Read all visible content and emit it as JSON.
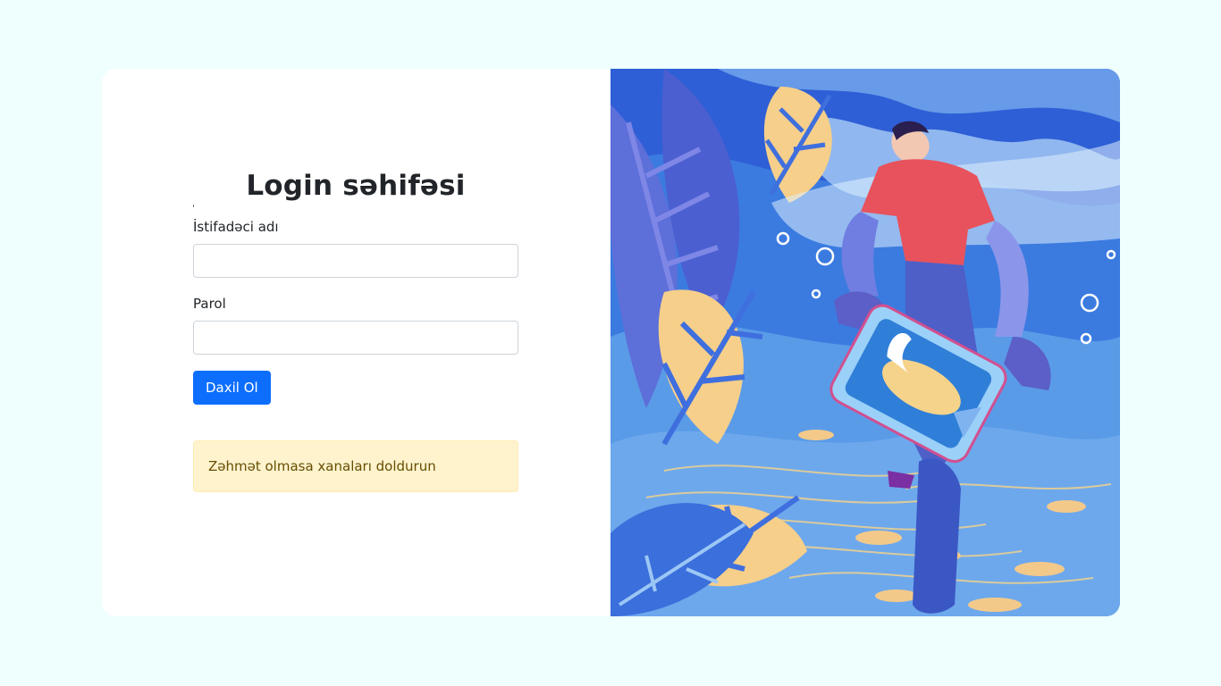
{
  "login": {
    "title": "Login səhifəsi",
    "username_label": "İstifadəci adı",
    "username_value": "",
    "password_label": "Parol",
    "password_value": "",
    "submit_label": "Daxil Ol",
    "alert_message": "Zəhmət olmasa xanaları doldurun"
  },
  "colors": {
    "page_background": "#eefffe",
    "primary_button": "#0d6efd",
    "alert_background": "#fff3cd",
    "alert_text": "#664d03"
  },
  "illustration": {
    "subject": "person-holding-phone-with-fish-illustration"
  }
}
